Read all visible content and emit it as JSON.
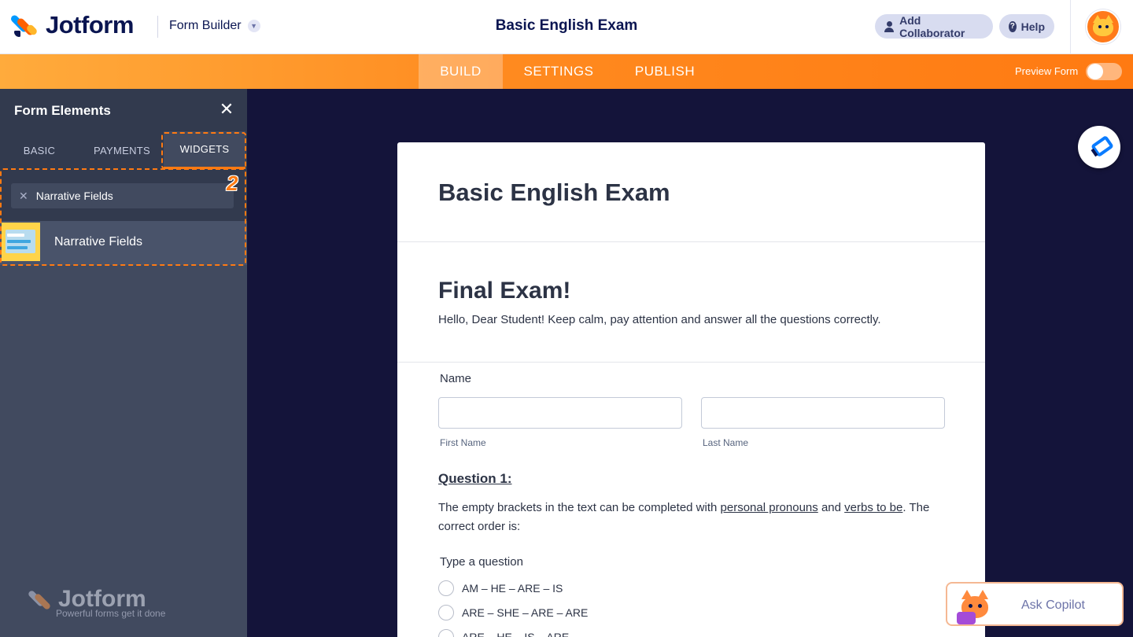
{
  "header": {
    "brand": "Jotform",
    "builder_label": "Form Builder",
    "title": "Basic English Exam",
    "add_collaborator": "Add Collaborator",
    "help": "Help"
  },
  "tabs": {
    "build": "BUILD",
    "settings": "SETTINGS",
    "publish": "PUBLISH",
    "active": "BUILD",
    "preview_label": "Preview Form",
    "preview_on": false
  },
  "sidebar": {
    "title": "Form Elements",
    "tabs": [
      "BASIC",
      "PAYMENTS",
      "WIDGETS"
    ],
    "active_tab": "WIDGETS",
    "search_value": "Narrative Fields",
    "results": [
      {
        "label": "Narrative Fields"
      }
    ],
    "step_badge": "2",
    "footer_brand": "Jotform",
    "footer_tagline": "Powerful forms get it done"
  },
  "form": {
    "title": "Basic English Exam",
    "heading": "Final Exam!",
    "subheading": "Hello, Dear Student! Keep calm, pay attention and answer all the questions correctly.",
    "name_label": "Name",
    "first_name": "First Name",
    "last_name": "Last Name",
    "question1": {
      "title": "Question 1:",
      "text_before": "The empty brackets in the text can be completed with ",
      "link1": "personal pronouns",
      "text_mid": " and ",
      "link2": "verbs to be",
      "text_after": ". The correct order is:",
      "label": "Type a question",
      "options": [
        "AM – HE – ARE – IS",
        "ARE – SHE – ARE – ARE",
        "ARE – HE – IS – ARE"
      ]
    }
  },
  "copilot": {
    "label": "Ask Copilot"
  },
  "colors": {
    "accent": "#ff7a12",
    "navy": "#0a1551",
    "canvas": "#14143a",
    "sidebar": "#414a5f"
  }
}
